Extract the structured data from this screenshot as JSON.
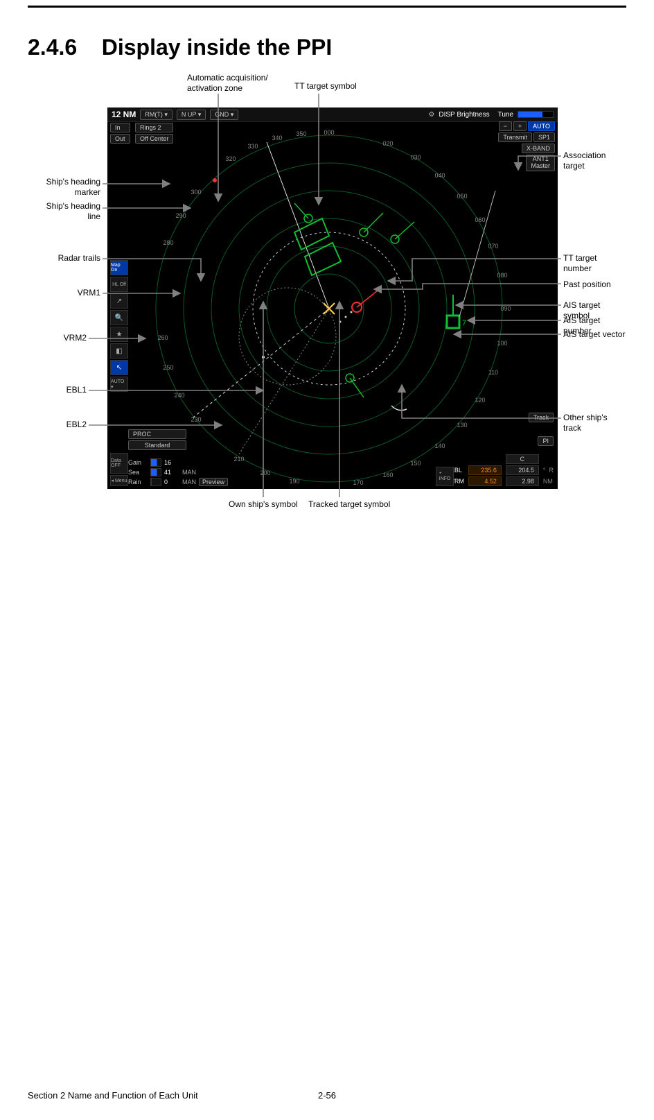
{
  "heading": {
    "number": "2.4.6",
    "title": "Display inside the PPI"
  },
  "footer": {
    "section": "Section 2    Name and Function of Each Unit",
    "page": "2-56"
  },
  "annotations": {
    "top": {
      "auto_zone": "Automatic acquisition/\nactivation zone",
      "tt_symbol": "TT target symbol"
    },
    "left": {
      "heading_marker": "Ship's heading\nmarker",
      "heading_line": "Ship's heading\nline",
      "radar_trails": "Radar trails",
      "vrm1": "VRM1",
      "vrm2": "VRM2",
      "ebl1": "EBL1",
      "ebl2": "EBL2"
    },
    "right": {
      "association_target": "Association target",
      "tt_target_number": "TT target number",
      "past_position": "Past position",
      "ais_symbol": "AIS target symbol",
      "ais_number": "AIS target number",
      "ais_vector": "AIS target vector",
      "other_track": "Other ship's track"
    },
    "bottom": {
      "own_ship": "Own ship's symbol",
      "tracked_target": "Tracked target symbol"
    }
  },
  "radar": {
    "range_label": "12 NM",
    "mode_rm": "RM(T) ▾",
    "mode_nup": "N UP ▾",
    "mode_gnd": "GND ▾",
    "brightness_label": "DISP Brightness",
    "tune_label": "Tune",
    "minus": "−",
    "plus": "+",
    "auto": "AUTO",
    "transmit": "Transmit",
    "sp1": "SP1",
    "xband": "X-BAND",
    "ant1": "ANT1",
    "master": "Master",
    "in": "In",
    "out": "Out",
    "rings": "Rings 2",
    "off_center": "Off Center",
    "track": "Track",
    "pi": "PI",
    "proc": "PROC",
    "standard": "Standard",
    "gain_label": "Gain",
    "gain_value": "16",
    "sea_label": "Sea",
    "sea_value": "41",
    "sea_mode": "MAN",
    "rain_label": "Rain",
    "rain_value": "0",
    "rain_mode": "MAN",
    "preview": "Preview",
    "readout": {
      "c": "C",
      "ebl_label": "EBL",
      "ebl1": "235.6",
      "ebl2": "204.5",
      "ebl_unit": "°",
      "r": "R",
      "vrm_label": "VRM",
      "vrm1": "4.52",
      "vrm2": "2.98",
      "vrm_unit": "NM",
      "plus_info": "+\nINFO"
    },
    "left_tool_labels": {
      "map_on": "Map\nOn",
      "hl_off": "HL\nOff",
      "share": "↗",
      "search": "🔍",
      "star": "★",
      "eraser": "◧",
      "cursor": "↖",
      "auto": "AUTO ▾",
      "data_off": "Data\nOFF",
      "menu": "◂ Menu"
    },
    "bearing_ticks": {
      "000": "000",
      "010": "",
      "020": "020",
      "030": "030",
      "040": "040",
      "050": "050",
      "060": "060",
      "070": "070",
      "080": "080",
      "090": "090",
      "100": "100",
      "110": "110",
      "120": "120",
      "130": "130",
      "140": "140",
      "150": "150",
      "160": "160",
      "170": "170",
      "180": "",
      "190": "190",
      "200": "200",
      "210": "210",
      "220": "",
      "230": "230",
      "240": "240",
      "250": "250",
      "260": "260",
      "270": "",
      "280": "280",
      "290": "290",
      "300": "300",
      "310": "",
      "320": "320",
      "330": "330",
      "340": "340",
      "350": "350"
    }
  }
}
